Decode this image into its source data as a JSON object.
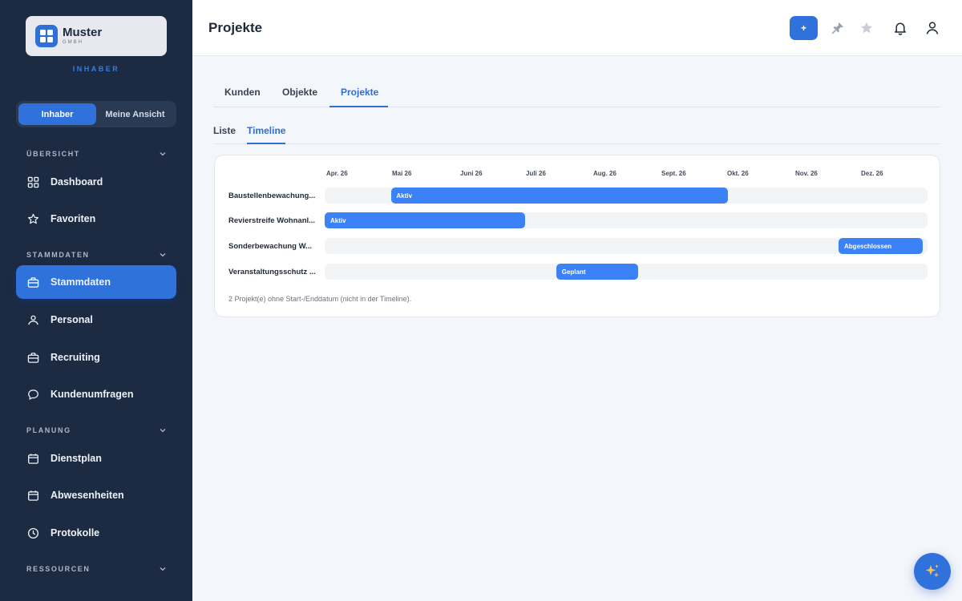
{
  "brand": {
    "name": "Muster",
    "sub": "GMBH",
    "role": "INHABER"
  },
  "view_toggle": {
    "options": [
      "Inhaber",
      "Meine Ansicht"
    ],
    "active": "Inhaber"
  },
  "sidebar": {
    "sections": [
      {
        "title": "ÜBERSICHT",
        "items": [
          {
            "label": "Dashboard",
            "icon": "grid-icon"
          },
          {
            "label": "Favoriten",
            "icon": "star-icon"
          }
        ]
      },
      {
        "title": "STAMMDATEN",
        "items": [
          {
            "label": "Stammdaten",
            "icon": "briefcase-icon",
            "active": true
          },
          {
            "label": "Personal",
            "icon": "people-icon"
          },
          {
            "label": "Recruiting",
            "icon": "briefcase-icon"
          },
          {
            "label": "Kundenumfragen",
            "icon": "chat-bubble-icon"
          }
        ]
      },
      {
        "title": "PLANUNG",
        "items": [
          {
            "label": "Dienstplan",
            "icon": "calendar-icon"
          },
          {
            "label": "Abwesenheiten",
            "icon": "calendar-icon"
          },
          {
            "label": "Protokolle",
            "icon": "clock-icon"
          }
        ]
      },
      {
        "title": "RESSOURCEN",
        "items": []
      }
    ]
  },
  "header": {
    "title": "Projekte",
    "add_label": "+"
  },
  "tabs": {
    "items": [
      "Kunden",
      "Objekte",
      "Projekte"
    ],
    "active": "Projekte"
  },
  "subtabs": {
    "items": [
      "Liste",
      "Timeline"
    ],
    "active": "Timeline"
  },
  "timeline": {
    "months": [
      "Apr. 26",
      "Mai 26",
      "Juni 26",
      "Juli 26",
      "Aug. 26",
      "Sept. 26",
      "Okt. 26",
      "Nov. 26",
      "Dez. 26"
    ],
    "rows": [
      {
        "label": "Baustellenbewachung...",
        "status": "Aktiv",
        "start": 1.0,
        "end": 6.1
      },
      {
        "label": "Revierstreife Wohnanl...",
        "status": "Aktiv",
        "start": 0.0,
        "end": 3.03
      },
      {
        "label": "Sonderbewachung W...",
        "status": "Abgeschlossen",
        "start": 7.77,
        "end": 9.04
      },
      {
        "label": "Veranstaltungsschutz ...",
        "status": "Geplant",
        "start": 3.5,
        "end": 4.74
      }
    ],
    "note": "2 Projekt(e) ohne Start-/Enddatum (nicht in der Timeline)."
  },
  "colors": {
    "accent": "#2f72dc",
    "sidebar_bg": "#1c2a42",
    "bar": "#3b82f6"
  }
}
